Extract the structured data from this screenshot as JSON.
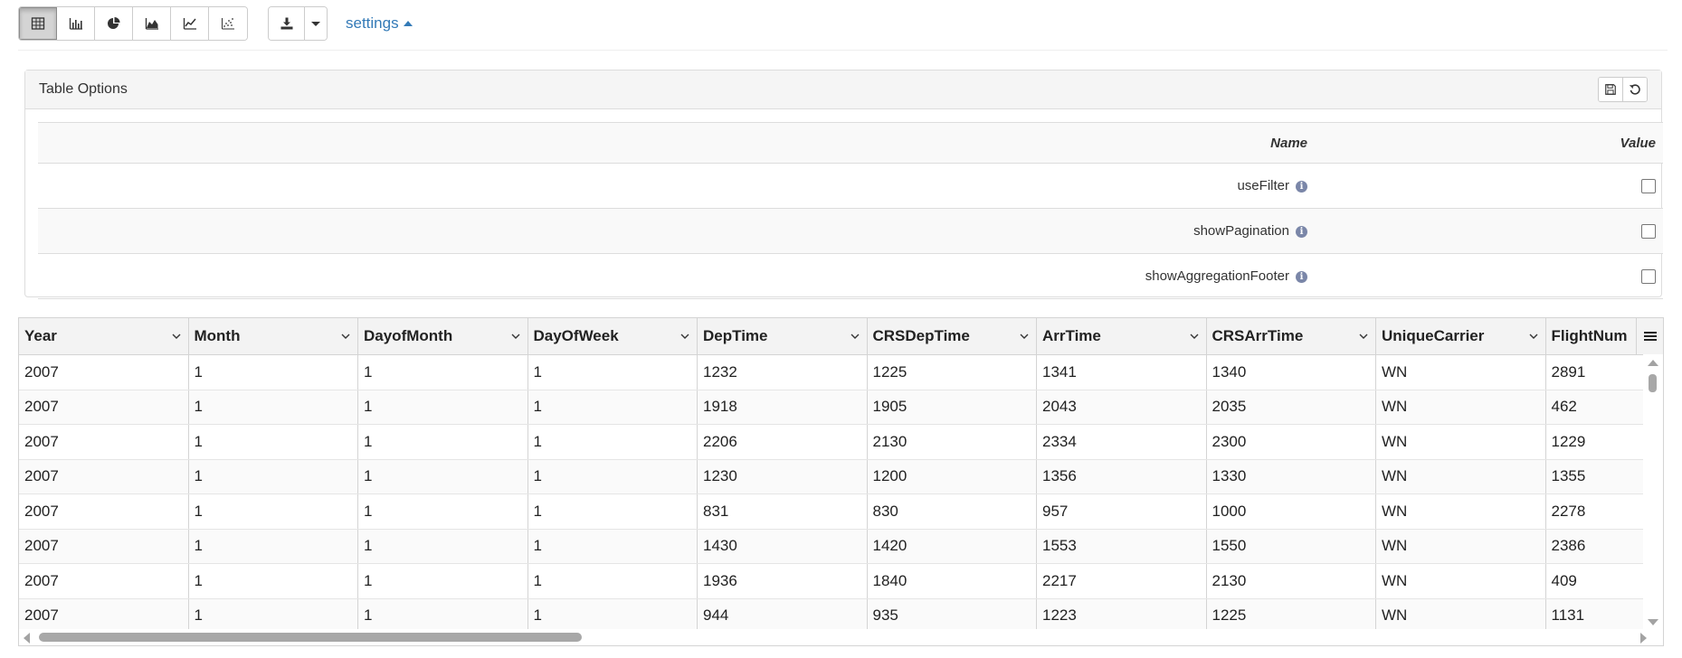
{
  "toolbar": {
    "view_buttons": [
      {
        "icon": "table-icon",
        "active": true
      },
      {
        "icon": "bar-chart-icon",
        "active": false
      },
      {
        "icon": "pie-chart-icon",
        "active": false
      },
      {
        "icon": "area-chart-icon",
        "active": false
      },
      {
        "icon": "line-chart-icon",
        "active": false
      },
      {
        "icon": "scatter-chart-icon",
        "active": false
      }
    ],
    "download_icon": "download-icon",
    "dropdown_icon": "caret-down-icon",
    "settings_label": "settings"
  },
  "table_options": {
    "title": "Table Options",
    "actions": [
      "save-icon",
      "reset-icon"
    ],
    "columns": {
      "name": "Name",
      "value": "Value"
    },
    "options": [
      {
        "name": "useFilter",
        "checked": false
      },
      {
        "name": "showPagination",
        "checked": false
      },
      {
        "name": "showAggregationFooter",
        "checked": false
      }
    ]
  },
  "grid": {
    "columns": [
      "Year",
      "Month",
      "DayofMonth",
      "DayOfWeek",
      "DepTime",
      "CRSDepTime",
      "ArrTime",
      "CRSArrTime",
      "UniqueCarrier",
      "FlightNum"
    ],
    "rows": [
      [
        "2007",
        "1",
        "1",
        "1",
        "1232",
        "1225",
        "1341",
        "1340",
        "WN",
        "2891"
      ],
      [
        "2007",
        "1",
        "1",
        "1",
        "1918",
        "1905",
        "2043",
        "2035",
        "WN",
        "462"
      ],
      [
        "2007",
        "1",
        "1",
        "1",
        "2206",
        "2130",
        "2334",
        "2300",
        "WN",
        "1229"
      ],
      [
        "2007",
        "1",
        "1",
        "1",
        "1230",
        "1200",
        "1356",
        "1330",
        "WN",
        "1355"
      ],
      [
        "2007",
        "1",
        "1",
        "1",
        "831",
        "830",
        "957",
        "1000",
        "WN",
        "2278"
      ],
      [
        "2007",
        "1",
        "1",
        "1",
        "1430",
        "1420",
        "1553",
        "1550",
        "WN",
        "2386"
      ],
      [
        "2007",
        "1",
        "1",
        "1",
        "1936",
        "1840",
        "2217",
        "2130",
        "WN",
        "409"
      ],
      [
        "2007",
        "1",
        "1",
        "1",
        "944",
        "935",
        "1223",
        "1225",
        "WN",
        "1131"
      ]
    ]
  },
  "colors": {
    "link": "#337ab7",
    "panel_heading": "#f5f5f5",
    "grid_header": "#f3f3f3",
    "border": "#dddddd"
  }
}
